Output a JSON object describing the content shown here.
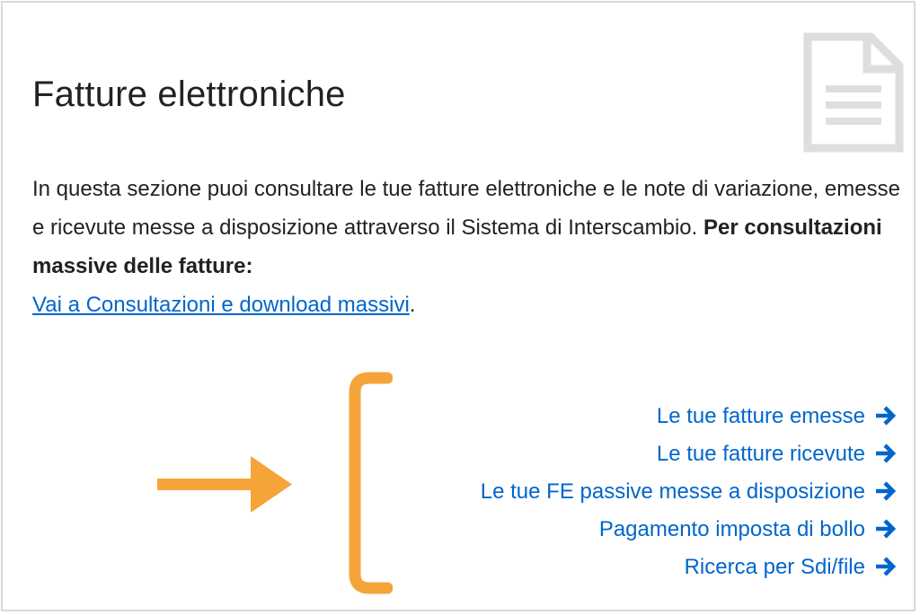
{
  "card": {
    "title": "Fatture elettroniche",
    "description_intro": "In questa sezione puoi consultare le tue fatture elettroniche e le note di variazione, emesse e ricevute messe a disposizione attraverso il Sistema di Interscambio. ",
    "description_bold": "Per consultazioni massive delle fatture:",
    "description_link": "Vai a Consultazioni e download massivi",
    "description_end": "."
  },
  "links": [
    {
      "label": "Le tue fatture emesse",
      "icon": "arrow-right-icon"
    },
    {
      "label": "Le tue fatture ricevute",
      "icon": "arrow-right-icon"
    },
    {
      "label": "Le tue FE passive messe a disposizione",
      "icon": "arrow-right-icon"
    },
    {
      "label": "Pagamento imposta di bollo",
      "icon": "arrow-right-icon"
    },
    {
      "label": "Ricerca per Sdi/file",
      "icon": "arrow-right-icon"
    }
  ],
  "icons": {
    "header": "document-icon"
  },
  "colors": {
    "link": "#0066cc",
    "annotation": "#f5a43a",
    "icon_gray": "#dedede",
    "text": "#222222"
  }
}
